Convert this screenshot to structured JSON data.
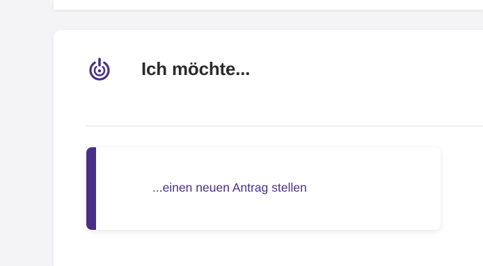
{
  "section": {
    "title": "Ich möchte...",
    "icon": "power-target-icon",
    "accent_color": "#4a2f86"
  },
  "actions": [
    {
      "label": "...einen neuen Antrag stellen"
    }
  ]
}
